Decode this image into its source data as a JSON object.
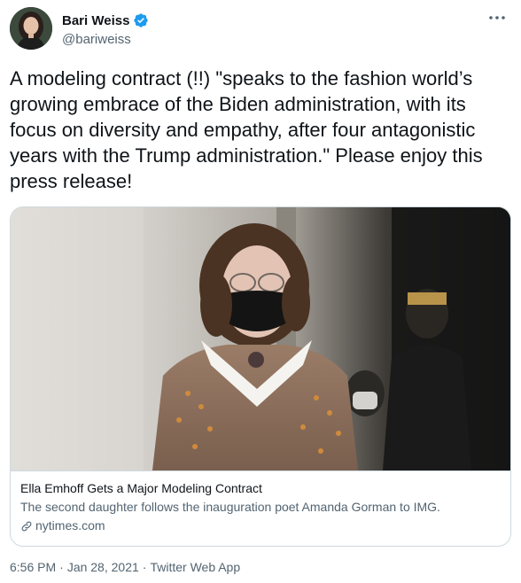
{
  "author": {
    "display_name": "Bari Weiss",
    "handle": "@bariweiss",
    "verified": true,
    "avatar_icon": "profile-photo"
  },
  "more_icon": "ellipsis-icon",
  "tweet": {
    "text": "A modeling contract (!!) \"speaks to the fashion world’s growing embrace of the Biden administration, with its focus on diversity and empathy, after four antagonistic years with the Trump administration.\" Please enjoy this press release!"
  },
  "card": {
    "title": "Ella Emhoff Gets a Major Modeling Contract",
    "description": "The second daughter follows the inauguration poet Amanda Gorman to IMG.",
    "domain": "nytimes.com",
    "domain_icon": "link-icon"
  },
  "meta": {
    "time": "6:56 PM",
    "separator": "·",
    "date": "Jan 28, 2021",
    "app": "Twitter Web App"
  },
  "colors": {
    "verified_blue": "#1d9bf0",
    "secondary_text": "#536471",
    "border": "#cfd9de"
  }
}
